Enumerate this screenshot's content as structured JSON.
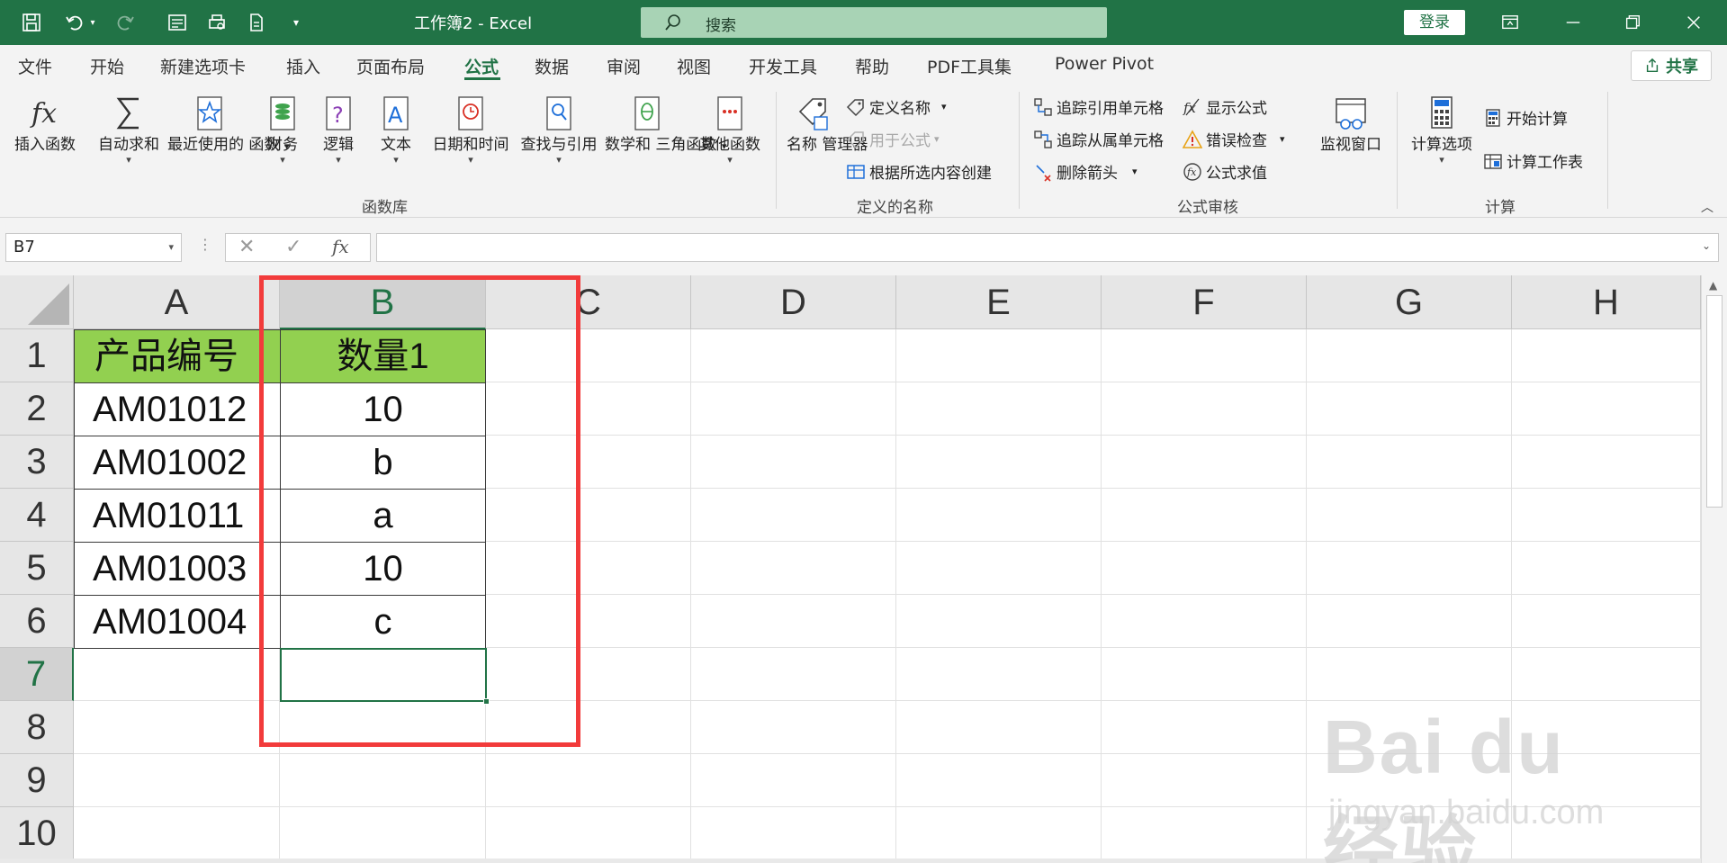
{
  "titlebar": {
    "doc_title": "工作簿2  -  Excel",
    "search_placeholder": "搜索",
    "login_label": "登录"
  },
  "tabs": [
    {
      "label": "文件",
      "active": false
    },
    {
      "label": "开始",
      "active": false
    },
    {
      "label": "新建选项卡",
      "active": false
    },
    {
      "label": "插入",
      "active": false
    },
    {
      "label": "页面布局",
      "active": false
    },
    {
      "label": "公式",
      "active": true
    },
    {
      "label": "数据",
      "active": false
    },
    {
      "label": "审阅",
      "active": false
    },
    {
      "label": "视图",
      "active": false
    },
    {
      "label": "开发工具",
      "active": false
    },
    {
      "label": "帮助",
      "active": false
    },
    {
      "label": "PDF工具集",
      "active": false
    },
    {
      "label": "Power Pivot",
      "active": false
    }
  ],
  "share_label": "共享",
  "ribbon": {
    "function_library": {
      "group_label": "函数库",
      "insert_function": "插入函数",
      "autosum": "自动求和",
      "recent_line1": "最近使用的",
      "recent_line2": "函数",
      "financial": "财务",
      "logical": "逻辑",
      "text": "文本",
      "datetime": "日期和时间",
      "lookup": "查找与引用",
      "math_line1": "数学和",
      "math_line2": "三角函数",
      "more": "其他函数"
    },
    "defined_names": {
      "group_label": "定义的名称",
      "name_manager_line1": "名称",
      "name_manager_line2": "管理器",
      "define_name": "定义名称",
      "use_in_formula": "用于公式",
      "create_from_selection": "根据所选内容创建"
    },
    "formula_auditing": {
      "group_label": "公式审核",
      "trace_precedents": "追踪引用单元格",
      "trace_dependents": "追踪从属单元格",
      "remove_arrows": "删除箭头",
      "show_formulas": "显示公式",
      "error_checking": "错误检查",
      "evaluate_formula": "公式求值",
      "watch_window": "监视窗口"
    },
    "calculation": {
      "group_label": "计算",
      "calc_options": "计算选项",
      "calc_now": "开始计算",
      "calc_sheet": "计算工作表"
    }
  },
  "formula_bar": {
    "name_box": "B7",
    "cancel_glyph": "✕",
    "enter_glyph": "✓",
    "fx_glyph": "fx",
    "formula": ""
  },
  "sheet": {
    "columns": [
      "A",
      "B",
      "C",
      "D",
      "E",
      "F",
      "G",
      "H"
    ],
    "rows": [
      "1",
      "2",
      "3",
      "4",
      "5",
      "6",
      "7",
      "8",
      "9",
      "10"
    ],
    "selected_column": "B",
    "selected_row": "7",
    "cells": {
      "A1": "产品编号",
      "B1": "数量1",
      "A2": "AM01012",
      "B2": "10",
      "A3": "AM01002",
      "B3": "b",
      "A4": "AM01011",
      "B4": "a",
      "A5": "AM01003",
      "B5": "10",
      "A6": "AM01004",
      "B6": "c"
    }
  },
  "watermark": {
    "brand": "Bai du 经验",
    "url": "jingyan.baidu.com"
  },
  "colors": {
    "accent": "#217346",
    "header_fill": "#92d050",
    "highlight_box": "#f23b3b"
  }
}
